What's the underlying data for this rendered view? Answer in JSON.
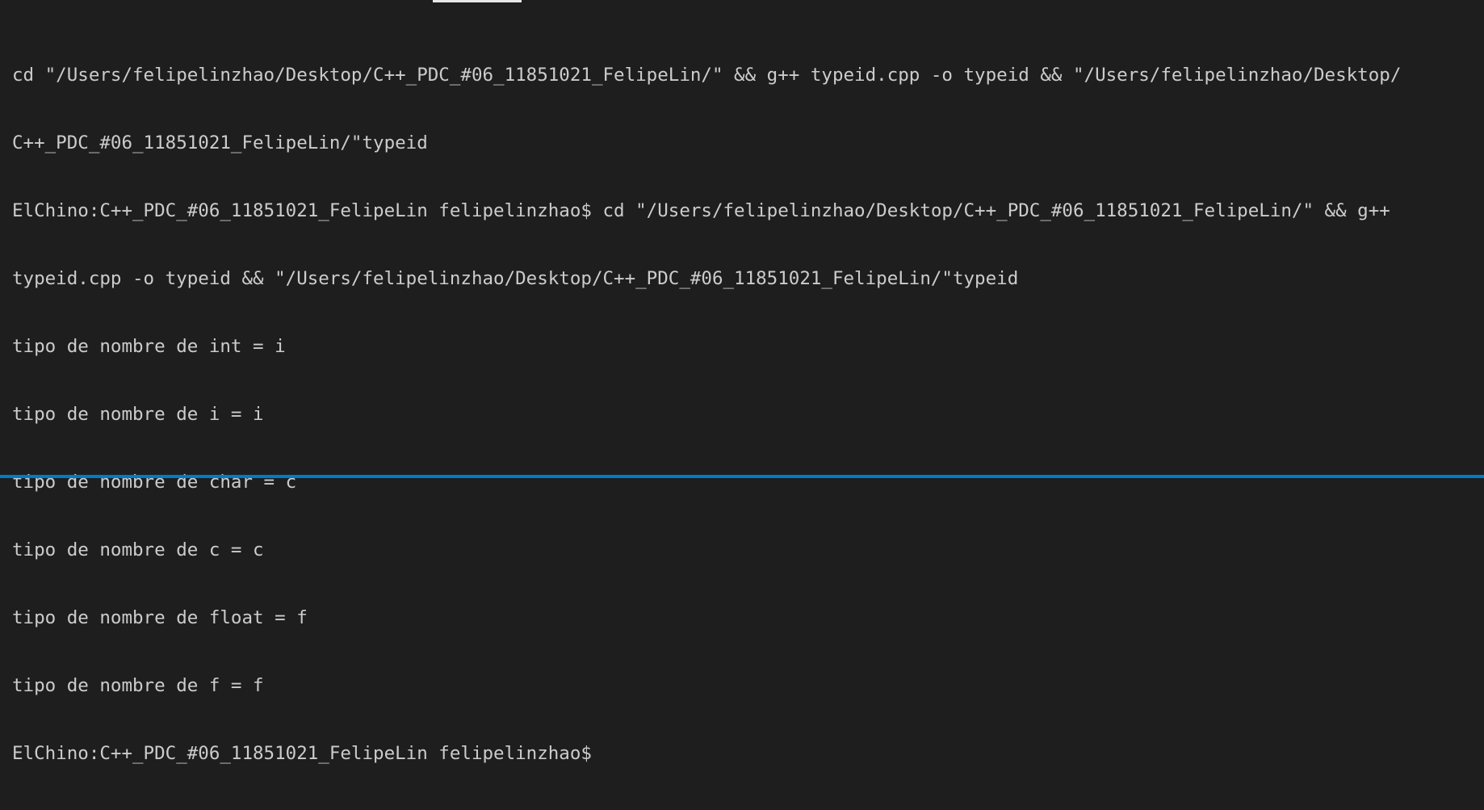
{
  "terminal": {
    "lines": [
      "cd \"/Users/felipelinzhao/Desktop/C++_PDC_#06_11851021_FelipeLin/\" && g++ typeid.cpp -o typeid && \"/Users/felipelinzhao/Desktop/",
      "C++_PDC_#06_11851021_FelipeLin/\"typeid",
      "ElChino:C++_PDC_#06_11851021_FelipeLin felipelinzhao$ cd \"/Users/felipelinzhao/Desktop/C++_PDC_#06_11851021_FelipeLin/\" && g++",
      "typeid.cpp -o typeid && \"/Users/felipelinzhao/Desktop/C++_PDC_#06_11851021_FelipeLin/\"typeid",
      "tipo de nombre de int = i",
      "tipo de nombre de i = i",
      "tipo de nombre de char = c",
      "tipo de nombre de c = c",
      "tipo de nombre de float = f",
      "tipo de nombre de f = f",
      "ElChino:C++_PDC_#06_11851021_FelipeLin felipelinzhao$"
    ]
  },
  "colors": {
    "background": "#1e1e1e",
    "foreground": "#cccccc",
    "accent": "#007acc"
  }
}
